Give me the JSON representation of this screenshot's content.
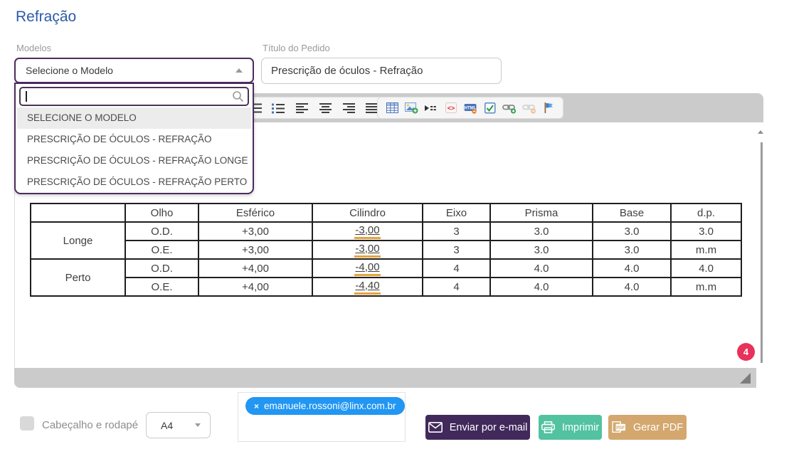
{
  "page": {
    "title": "Refração"
  },
  "modelos": {
    "label": "Modelos",
    "selected": "Selecione o Modelo",
    "search_value": "",
    "options": [
      "SELECIONE O MODELO",
      "PRESCRIÇÃO DE ÓCULOS - REFRAÇÃO",
      "PRESCRIÇÃO DE ÓCULOS - REFRAÇÃO LONGE",
      "PRESCRIÇÃO DE ÓCULOS - REFRAÇÃO PERTO"
    ]
  },
  "titulo": {
    "label": "Título do Pedido",
    "value": "Prescrição de óculos - Refração"
  },
  "editor": {
    "toolbar": {
      "group1": [
        "ordered-list",
        "unordered-list",
        "align-left",
        "align-center",
        "align-right",
        "align-justify"
      ],
      "group2": [
        "insert-table",
        "insert-image",
        "page-break",
        "source-code",
        "clean-html",
        "checkbox",
        "insert-link",
        "remove-link",
        "flag"
      ]
    },
    "badge_count": "4",
    "table": {
      "headers": [
        "",
        "Olho",
        "Esférico",
        "Cilindro",
        "Eixo",
        "Prisma",
        "Base",
        "d.p."
      ],
      "groups": [
        {
          "label": "Longe",
          "rows": [
            {
              "olho": "O.D.",
              "esferico": "+3,00",
              "cilindro": "-3,00",
              "eixo": "3",
              "prisma": "3.0",
              "base": "3.0",
              "dp": "3.0"
            },
            {
              "olho": "O.E.",
              "esferico": "+3,00",
              "cilindro": "-3,00",
              "eixo": "3",
              "prisma": "3.0",
              "base": "3.0",
              "dp": "m.m"
            }
          ]
        },
        {
          "label": "Perto",
          "rows": [
            {
              "olho": "O.D.",
              "esferico": "+4,00",
              "cilindro": "-4,00",
              "eixo": "4",
              "prisma": "4.0",
              "base": "4.0",
              "dp": "4.0"
            },
            {
              "olho": "O.E.",
              "esferico": "+4,00",
              "cilindro": "-4,40",
              "eixo": "4",
              "prisma": "4.0",
              "base": "4.0",
              "dp": "m.m"
            }
          ]
        }
      ]
    }
  },
  "footer": {
    "checkbox_label": "Cabeçalho e rodapé",
    "paper_size": "A4",
    "email_chip": "emanuele.rossoni@linx.com.br",
    "email_chip_close": "×",
    "send_email_label": "Enviar por e-mail",
    "print_label": "Imprimir",
    "pdf_label": "Gerar PDF"
  },
  "colors": {
    "title_blue": "#2d5aa9",
    "dropdown_purple": "#4c2b5e",
    "chip_blue": "#2196f3",
    "badge_red": "#e8315b",
    "button_purple": "#41295b",
    "button_green": "#52c2a0",
    "button_tan": "#d3a76e",
    "underline_orange": "#e5a33c"
  }
}
